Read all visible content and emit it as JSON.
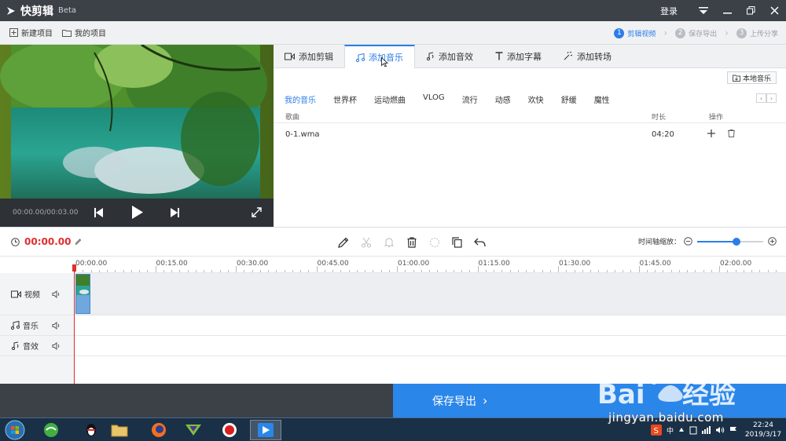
{
  "app": {
    "title": "快剪辑",
    "badge": "Beta",
    "login": "登录"
  },
  "toolbar": {
    "new_project": "新建项目",
    "my_projects": "我的项目"
  },
  "steps": [
    {
      "num": "1",
      "label": "剪辑视频",
      "active": true
    },
    {
      "num": "2",
      "label": "保存导出",
      "active": false
    },
    {
      "num": "3",
      "label": "上传分享",
      "active": false
    }
  ],
  "preview": {
    "time": "00:00.00/00:03.00"
  },
  "tabs": [
    {
      "label": "添加剪辑",
      "icon": "video-icon"
    },
    {
      "label": "添加音乐",
      "icon": "music-note-icon",
      "active": true
    },
    {
      "label": "添加音效",
      "icon": "sound-effect-icon"
    },
    {
      "label": "添加字幕",
      "icon": "text-icon"
    },
    {
      "label": "添加转场",
      "icon": "transition-icon"
    }
  ],
  "music": {
    "local_button": "本地音乐",
    "categories": [
      "我的音乐",
      "世界杯",
      "运动燃曲",
      "VLOG",
      "流行",
      "动感",
      "欢快",
      "舒缓",
      "魔性"
    ],
    "active_category": 0,
    "columns": {
      "name": "歌曲",
      "duration": "时长",
      "actions": "操作"
    },
    "rows": [
      {
        "name": "0-1.wma",
        "duration": "04:20"
      }
    ]
  },
  "timeline_toolbar": {
    "current_time": "00:00.00",
    "zoom_label": "时间轴缩放：",
    "zoom_level": 0.6,
    "tools": [
      "pencil-icon",
      "scissors-icon",
      "bell-icon",
      "trash-icon",
      "crop-icon",
      "copy-icon",
      "undo-icon"
    ]
  },
  "timeline": {
    "ticks": [
      "00:00.00",
      "00:15.00",
      "00:30.00",
      "00:45.00",
      "01:00.00",
      "01:15.00",
      "01:30.00",
      "01:45.00",
      "02:00.00"
    ],
    "tracks": {
      "video": "视频",
      "music": "音乐",
      "sfx": "音效"
    }
  },
  "footer": {
    "export": "保存导出",
    "export_arrow": "›"
  },
  "taskbar": {
    "time": "22:24",
    "date": "2019/3/17",
    "ime": "中"
  },
  "watermark": {
    "text": "jingyan.baidu.com"
  },
  "colors": {
    "accent": "#2b86ea",
    "titlebar": "#3c4047",
    "playhead": "#e02d2d"
  }
}
